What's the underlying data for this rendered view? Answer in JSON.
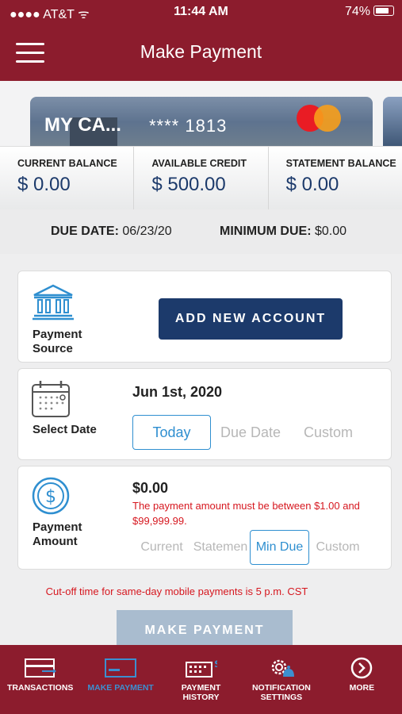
{
  "status": {
    "carrier": "AT&T",
    "time": "11:44 AM",
    "battery": "74%"
  },
  "header": {
    "title": "Make Payment"
  },
  "card": {
    "name": "MY CA...",
    "number": "**** 1813"
  },
  "balances": [
    {
      "label": "CURRENT BALANCE",
      "value": "$ 0.00"
    },
    {
      "label": "AVAILABLE CREDIT",
      "value": "$ 500.00"
    },
    {
      "label": "STATEMENT BALANCE",
      "value": "$ 0.00"
    }
  ],
  "due": {
    "due_label": "DUE DATE:",
    "due_value": "06/23/20",
    "min_label": "MINIMUM DUE:",
    "min_value": "$0.00"
  },
  "source": {
    "label_line1": "Payment",
    "label_line2": "Source",
    "button": "ADD NEW ACCOUNT",
    "icon": "bank-icon"
  },
  "date": {
    "label": "Select Date",
    "value": "Jun 1st, 2020",
    "options": [
      "Today",
      "Due Date",
      "Custom"
    ],
    "selected": "Today",
    "icon": "calendar-icon"
  },
  "amount": {
    "label_line1": "Payment",
    "label_line2": "Amount",
    "value": "$0.00",
    "error": "The payment amount must be between $1.00 and $99,999.99.",
    "options": [
      "Current",
      "Statemen",
      "Min Due",
      "Custom"
    ],
    "selected": "Min Due",
    "icon": "dollar-icon"
  },
  "cutoff": "Cut-off time for same-day mobile payments is 5 p.m. CST",
  "make_payment": "MAKE PAYMENT",
  "tabs": [
    {
      "label": "TRANSACTIONS",
      "icon": "transactions-icon"
    },
    {
      "label": "MAKE PAYMENT",
      "icon": "card-icon"
    },
    {
      "label_line1": "PAYMENT",
      "label_line2": "HISTORY",
      "icon": "history-icon"
    },
    {
      "label_line1": "NOTIFICATION",
      "label_line2": "SETTINGS",
      "icon": "notification-gear-icon"
    },
    {
      "label": "MORE",
      "icon": "more-icon"
    }
  ],
  "colors": {
    "brand": "#8c1c2d",
    "navy": "#1c3a6b",
    "accent": "#2f8fd0",
    "error": "#d6171f"
  }
}
